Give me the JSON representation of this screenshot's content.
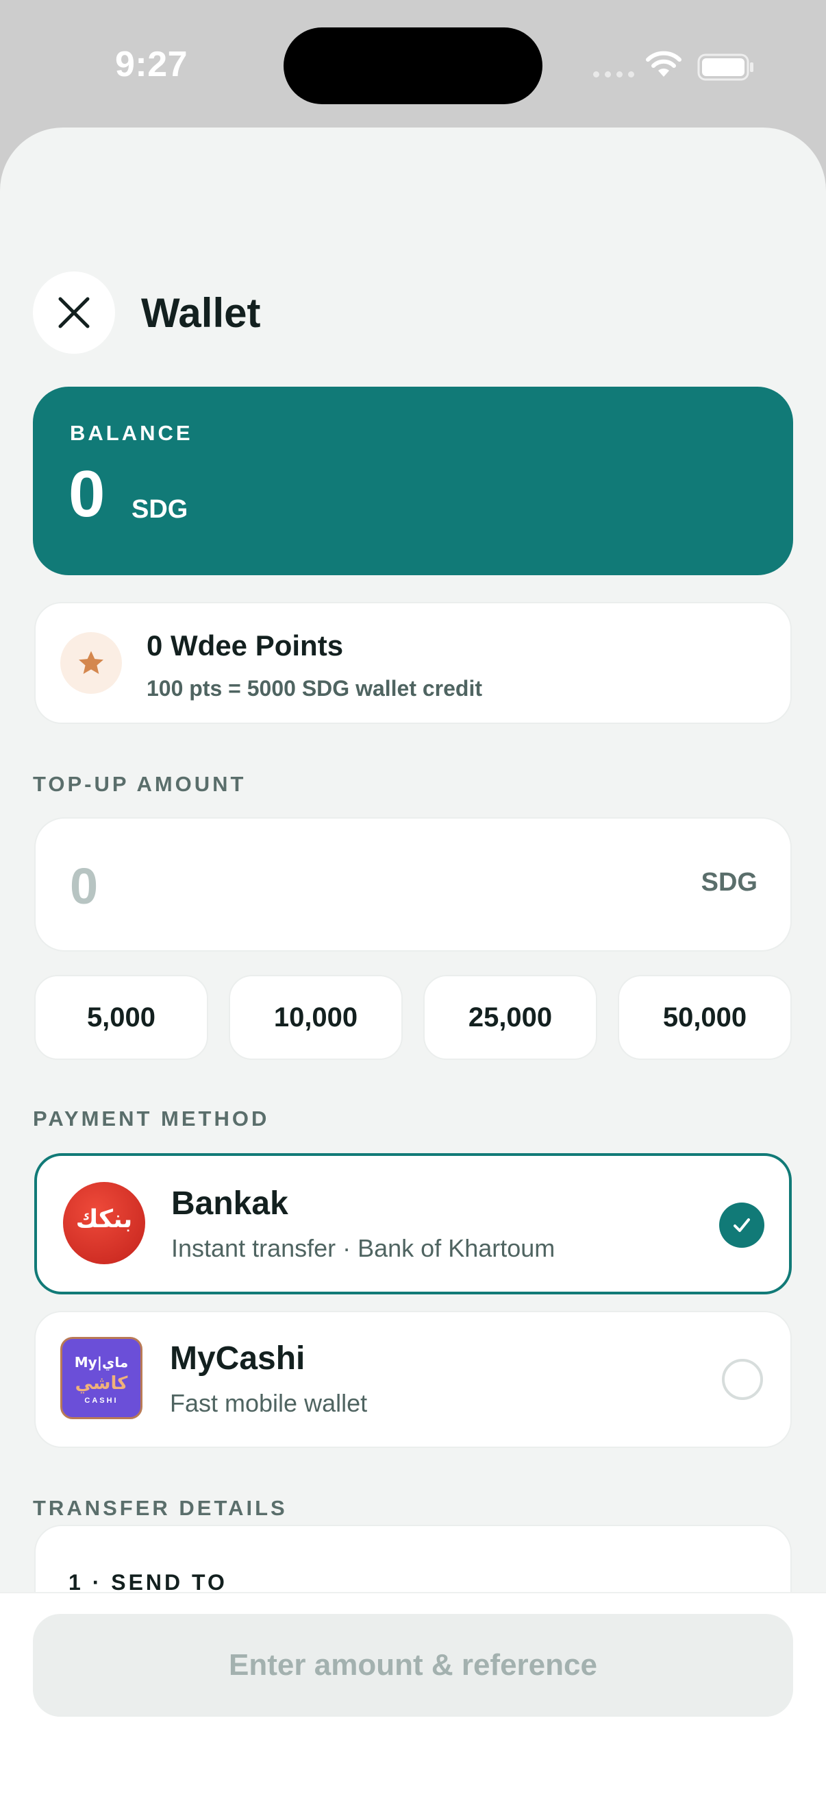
{
  "status_bar": {
    "time": "9:27"
  },
  "header": {
    "title": "Wallet"
  },
  "balance": {
    "label": "BALANCE",
    "amount": "0",
    "currency": "SDG"
  },
  "points": {
    "title": "0 Wdee Points",
    "subtitle": "100 pts = 5000 SDG wallet credit"
  },
  "topup": {
    "label": "TOP-UP AMOUNT",
    "value": "0",
    "currency": "SDG",
    "presets": [
      "5,000",
      "10,000",
      "25,000",
      "50,000"
    ]
  },
  "payment": {
    "label": "PAYMENT METHOD",
    "methods": [
      {
        "name": "Bankak",
        "description": "Instant transfer · Bank of Khartoum",
        "logo_text": "بنكك",
        "selected": true
      },
      {
        "name": "MyCashi",
        "description": "Fast mobile wallet",
        "logo_text_top": "My|ماي",
        "logo_text_mid": "كاشي",
        "logo_text_bottom": "CASHI",
        "selected": false
      }
    ]
  },
  "transfer": {
    "label": "TRANSFER DETAILS",
    "step": "1 · SEND TO"
  },
  "footer": {
    "submit_label": "Enter amount & reference"
  },
  "colors": {
    "accent": "#117a77",
    "background": "#f2f4f3",
    "points_star": "#d4874e",
    "bankak_red": "#d62f27",
    "mycashi_purple": "#6b4fd8"
  }
}
